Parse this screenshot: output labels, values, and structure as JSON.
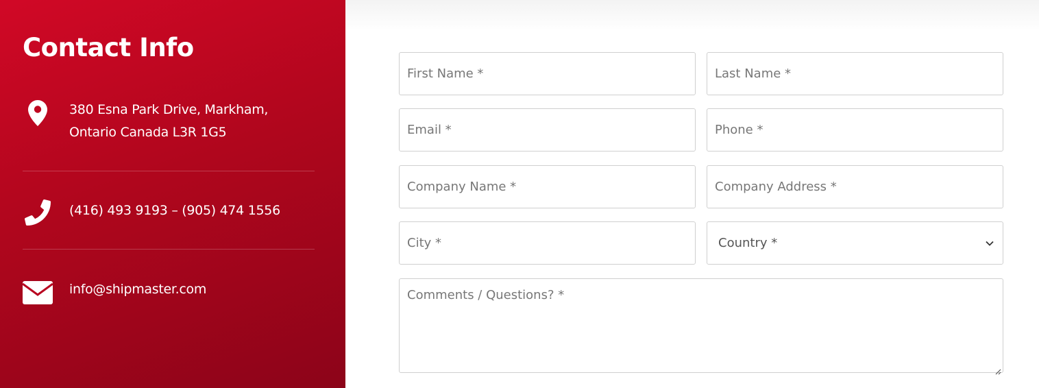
{
  "contact": {
    "title": "Contact Info",
    "address_line1": "380 Esna Park Drive, Markham,",
    "address_line2": "Ontario Canada L3R 1G5",
    "phone": "(416) 493 9193 – (905) 474 1556",
    "email": "info@shipmaster.com",
    "icons": [
      "location-pin-icon",
      "phone-icon",
      "envelope-icon"
    ],
    "panel_color": "#c1071f"
  },
  "form": {
    "first_name_placeholder": "First Name *",
    "last_name_placeholder": "Last Name *",
    "email_placeholder": "Email *",
    "phone_placeholder": "Phone *",
    "company_name_placeholder": "Company Name *",
    "company_address_placeholder": "Company Address *",
    "city_placeholder": "City *",
    "country_selected": "Country *",
    "comments_placeholder": "Comments / Questions? *"
  }
}
